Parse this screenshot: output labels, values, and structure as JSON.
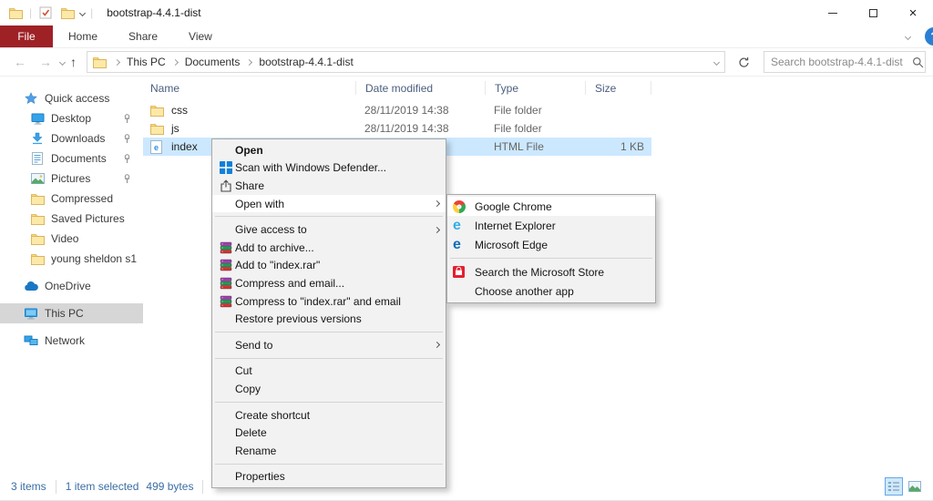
{
  "window": {
    "title": "bootstrap-4.4.1-dist",
    "titlebar_icons": [
      "folder-icon",
      "properties-check-icon",
      "new-folder-icon",
      "toolbar-dropdown-icon"
    ],
    "controls": [
      "minimize-button",
      "maximize-button",
      "close-button"
    ]
  },
  "ribbon": {
    "file_tab": "File",
    "tabs": [
      "Home",
      "Share",
      "View"
    ],
    "right_icons": [
      "minimize-ribbon-icon",
      "help-icon"
    ]
  },
  "navbar": {
    "icons": [
      "back-arrow-icon",
      "forward-arrow-icon",
      "history-dropdown-icon",
      "up-arrow-icon",
      "address-dropdown-icon",
      "refresh-icon",
      "search-icon"
    ],
    "breadcrumb": [
      "This PC",
      "Documents",
      "bootstrap-4.4.1-dist"
    ],
    "search_placeholder": "Search bootstrap-4.4.1-dist"
  },
  "sidebar": {
    "items": [
      {
        "label": "Quick access",
        "icon": "star",
        "child": false
      },
      {
        "label": "Desktop",
        "icon": "desktop",
        "child": true,
        "pinned": true
      },
      {
        "label": "Downloads",
        "icon": "downloads",
        "child": true,
        "pinned": true
      },
      {
        "label": "Documents",
        "icon": "documents",
        "child": true,
        "pinned": true
      },
      {
        "label": "Pictures",
        "icon": "pictures",
        "child": true,
        "pinned": true
      },
      {
        "label": "Compressed",
        "icon": "folder",
        "child": true
      },
      {
        "label": "Saved Pictures",
        "icon": "folder",
        "child": true
      },
      {
        "label": "Video",
        "icon": "folder",
        "child": true
      },
      {
        "label": "young sheldon s1",
        "icon": "folder",
        "child": true
      },
      {
        "label": "OneDrive",
        "icon": "onedrive",
        "gap": true
      },
      {
        "label": "This PC",
        "icon": "thispc",
        "gap": true,
        "selected": true
      },
      {
        "label": "Network",
        "icon": "network",
        "gap": true
      }
    ]
  },
  "file_list": {
    "columns": [
      "Name",
      "Date modified",
      "Type",
      "Size"
    ],
    "rows": [
      {
        "name": "css",
        "icon": "folder",
        "date": "28/11/2019 14:38",
        "type": "File folder",
        "size": ""
      },
      {
        "name": "js",
        "icon": "folder",
        "date": "28/11/2019 14:38",
        "type": "File folder",
        "size": ""
      },
      {
        "name": "index",
        "icon": "html",
        "date": "",
        "type": "HTML File",
        "size": "1 KB",
        "selected": true
      }
    ]
  },
  "context_menu": {
    "items": [
      {
        "label": "Open",
        "bold": true
      },
      {
        "label": "Scan with Windows Defender...",
        "icon": "defender"
      },
      {
        "label": "Share",
        "icon": "share"
      },
      {
        "label": "Open with",
        "submenu": true,
        "highlighted": true
      },
      {
        "separator": true
      },
      {
        "label": "Give access to",
        "submenu": true
      },
      {
        "label": "Add to archive...",
        "icon": "winrar"
      },
      {
        "label": "Add to \"index.rar\"",
        "icon": "winrar"
      },
      {
        "label": "Compress and email...",
        "icon": "winrar"
      },
      {
        "label": "Compress to \"index.rar\" and email",
        "icon": "winrar"
      },
      {
        "label": "Restore previous versions"
      },
      {
        "separator": true
      },
      {
        "label": "Send to",
        "submenu": true
      },
      {
        "separator": true
      },
      {
        "label": "Cut"
      },
      {
        "label": "Copy"
      },
      {
        "separator": true
      },
      {
        "label": "Create shortcut"
      },
      {
        "label": "Delete"
      },
      {
        "label": "Rename"
      },
      {
        "separator": true
      },
      {
        "label": "Properties"
      }
    ]
  },
  "open_with_submenu": {
    "items": [
      {
        "label": "Google Chrome",
        "icon": "chrome",
        "highlighted": true
      },
      {
        "label": "Internet Explorer",
        "icon": "ie"
      },
      {
        "label": "Microsoft Edge",
        "icon": "edge"
      },
      {
        "separator": true
      },
      {
        "label": "Search the Microsoft Store",
        "icon": "store"
      },
      {
        "label": "Choose another app"
      }
    ]
  },
  "status_bar": {
    "items_count": "3 items",
    "selection": "1 item selected",
    "selection_size": "499 bytes",
    "view_buttons": [
      "details-view-button",
      "thumbnails-view-button"
    ]
  },
  "colors": {
    "file_tab_bg": "#9e2126",
    "selection_bg": "#cce8ff",
    "sidebar_selected_bg": "#d6d6d6",
    "menu_bg": "#f2f2f2",
    "status_text": "#3a6da5"
  }
}
